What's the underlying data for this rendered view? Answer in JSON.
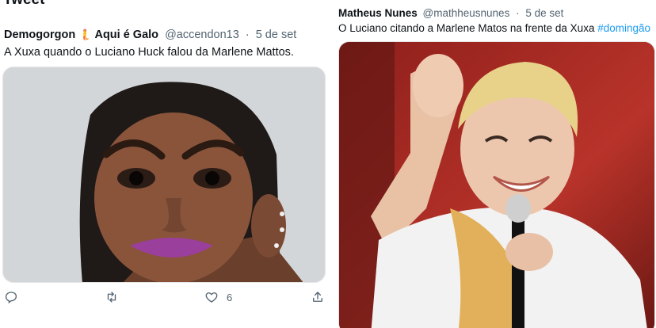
{
  "page": {
    "header_partial": "Tweet"
  },
  "left_tweet": {
    "author_name": "Demogorgon",
    "author_emoji": "🧜",
    "author_name_suffix": "Aqui é Galo",
    "handle": "@accendon13",
    "separator": "·",
    "date": "5 de set",
    "text": "A Xuxa quando o Luciano Huck falou da Marlene Mattos.",
    "image_label": "meme photo",
    "actions": {
      "reply_icon": "reply-icon",
      "retweet_icon": "retweet-icon",
      "like_icon": "heart-icon",
      "like_count": "6",
      "share_icon": "share-icon"
    }
  },
  "right_tweet": {
    "author_name": "Matheus Nunes",
    "handle": "@mathheusnunes",
    "separator": "·",
    "date": "5 de set",
    "text_plain": "O Luciano citando a Marlene Matos na frente da Xuxa ",
    "hashtag": "#domingão",
    "image_label": "photo of woman waving with microphone"
  },
  "colors": {
    "text": "#0f1419",
    "muted": "#536471",
    "link": "#1d9bf0"
  }
}
